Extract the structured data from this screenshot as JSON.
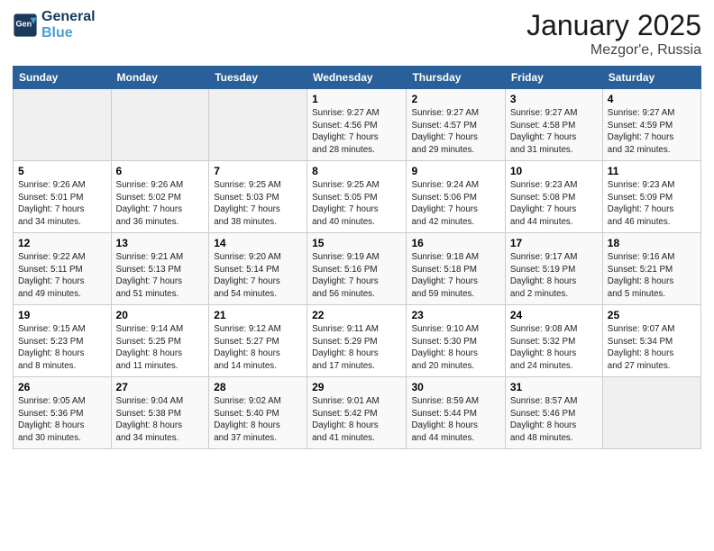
{
  "logo": {
    "line1": "General",
    "line2": "Blue"
  },
  "title": "January 2025",
  "location": "Mezgor'e, Russia",
  "days_of_week": [
    "Sunday",
    "Monday",
    "Tuesday",
    "Wednesday",
    "Thursday",
    "Friday",
    "Saturday"
  ],
  "weeks": [
    [
      {
        "num": "",
        "info": ""
      },
      {
        "num": "",
        "info": ""
      },
      {
        "num": "",
        "info": ""
      },
      {
        "num": "1",
        "info": "Sunrise: 9:27 AM\nSunset: 4:56 PM\nDaylight: 7 hours\nand 28 minutes."
      },
      {
        "num": "2",
        "info": "Sunrise: 9:27 AM\nSunset: 4:57 PM\nDaylight: 7 hours\nand 29 minutes."
      },
      {
        "num": "3",
        "info": "Sunrise: 9:27 AM\nSunset: 4:58 PM\nDaylight: 7 hours\nand 31 minutes."
      },
      {
        "num": "4",
        "info": "Sunrise: 9:27 AM\nSunset: 4:59 PM\nDaylight: 7 hours\nand 32 minutes."
      }
    ],
    [
      {
        "num": "5",
        "info": "Sunrise: 9:26 AM\nSunset: 5:01 PM\nDaylight: 7 hours\nand 34 minutes."
      },
      {
        "num": "6",
        "info": "Sunrise: 9:26 AM\nSunset: 5:02 PM\nDaylight: 7 hours\nand 36 minutes."
      },
      {
        "num": "7",
        "info": "Sunrise: 9:25 AM\nSunset: 5:03 PM\nDaylight: 7 hours\nand 38 minutes."
      },
      {
        "num": "8",
        "info": "Sunrise: 9:25 AM\nSunset: 5:05 PM\nDaylight: 7 hours\nand 40 minutes."
      },
      {
        "num": "9",
        "info": "Sunrise: 9:24 AM\nSunset: 5:06 PM\nDaylight: 7 hours\nand 42 minutes."
      },
      {
        "num": "10",
        "info": "Sunrise: 9:23 AM\nSunset: 5:08 PM\nDaylight: 7 hours\nand 44 minutes."
      },
      {
        "num": "11",
        "info": "Sunrise: 9:23 AM\nSunset: 5:09 PM\nDaylight: 7 hours\nand 46 minutes."
      }
    ],
    [
      {
        "num": "12",
        "info": "Sunrise: 9:22 AM\nSunset: 5:11 PM\nDaylight: 7 hours\nand 49 minutes."
      },
      {
        "num": "13",
        "info": "Sunrise: 9:21 AM\nSunset: 5:13 PM\nDaylight: 7 hours\nand 51 minutes."
      },
      {
        "num": "14",
        "info": "Sunrise: 9:20 AM\nSunset: 5:14 PM\nDaylight: 7 hours\nand 54 minutes."
      },
      {
        "num": "15",
        "info": "Sunrise: 9:19 AM\nSunset: 5:16 PM\nDaylight: 7 hours\nand 56 minutes."
      },
      {
        "num": "16",
        "info": "Sunrise: 9:18 AM\nSunset: 5:18 PM\nDaylight: 7 hours\nand 59 minutes."
      },
      {
        "num": "17",
        "info": "Sunrise: 9:17 AM\nSunset: 5:19 PM\nDaylight: 8 hours\nand 2 minutes."
      },
      {
        "num": "18",
        "info": "Sunrise: 9:16 AM\nSunset: 5:21 PM\nDaylight: 8 hours\nand 5 minutes."
      }
    ],
    [
      {
        "num": "19",
        "info": "Sunrise: 9:15 AM\nSunset: 5:23 PM\nDaylight: 8 hours\nand 8 minutes."
      },
      {
        "num": "20",
        "info": "Sunrise: 9:14 AM\nSunset: 5:25 PM\nDaylight: 8 hours\nand 11 minutes."
      },
      {
        "num": "21",
        "info": "Sunrise: 9:12 AM\nSunset: 5:27 PM\nDaylight: 8 hours\nand 14 minutes."
      },
      {
        "num": "22",
        "info": "Sunrise: 9:11 AM\nSunset: 5:29 PM\nDaylight: 8 hours\nand 17 minutes."
      },
      {
        "num": "23",
        "info": "Sunrise: 9:10 AM\nSunset: 5:30 PM\nDaylight: 8 hours\nand 20 minutes."
      },
      {
        "num": "24",
        "info": "Sunrise: 9:08 AM\nSunset: 5:32 PM\nDaylight: 8 hours\nand 24 minutes."
      },
      {
        "num": "25",
        "info": "Sunrise: 9:07 AM\nSunset: 5:34 PM\nDaylight: 8 hours\nand 27 minutes."
      }
    ],
    [
      {
        "num": "26",
        "info": "Sunrise: 9:05 AM\nSunset: 5:36 PM\nDaylight: 8 hours\nand 30 minutes."
      },
      {
        "num": "27",
        "info": "Sunrise: 9:04 AM\nSunset: 5:38 PM\nDaylight: 8 hours\nand 34 minutes."
      },
      {
        "num": "28",
        "info": "Sunrise: 9:02 AM\nSunset: 5:40 PM\nDaylight: 8 hours\nand 37 minutes."
      },
      {
        "num": "29",
        "info": "Sunrise: 9:01 AM\nSunset: 5:42 PM\nDaylight: 8 hours\nand 41 minutes."
      },
      {
        "num": "30",
        "info": "Sunrise: 8:59 AM\nSunset: 5:44 PM\nDaylight: 8 hours\nand 44 minutes."
      },
      {
        "num": "31",
        "info": "Sunrise: 8:57 AM\nSunset: 5:46 PM\nDaylight: 8 hours\nand 48 minutes."
      },
      {
        "num": "",
        "info": ""
      }
    ]
  ]
}
